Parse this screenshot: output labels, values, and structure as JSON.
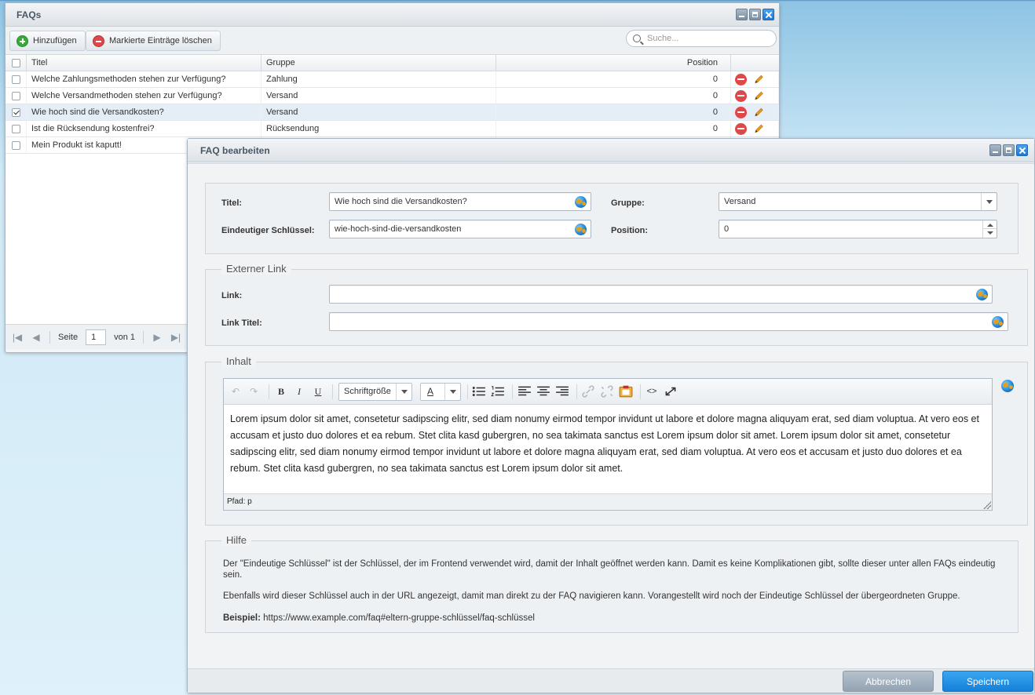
{
  "list_window": {
    "title": "FAQs",
    "add_label": "Hinzufügen",
    "delete_label": "Markierte Einträge löschen",
    "search_placeholder": "Suche...",
    "columns": {
      "title": "Titel",
      "group": "Gruppe",
      "position": "Position"
    },
    "rows": [
      {
        "title": "Welche Zahlungsmethoden stehen zur Verfügung?",
        "group": "Zahlung",
        "position": "0",
        "checked": false
      },
      {
        "title": "Welche Versandmethoden stehen zur Verfügung?",
        "group": "Versand",
        "position": "0",
        "checked": false
      },
      {
        "title": "Wie hoch sind die Versandkosten?",
        "group": "Versand",
        "position": "0",
        "checked": true
      },
      {
        "title": "Ist die Rücksendung kostenfrei?",
        "group": "Rücksendung",
        "position": "0",
        "checked": false
      },
      {
        "title": "Mein Produkt ist kaputt!",
        "group": "",
        "position": "",
        "checked": false
      }
    ],
    "pager": {
      "page_label": "Seite",
      "page": "1",
      "of_label": "von 1"
    }
  },
  "edit_window": {
    "title": "FAQ bearbeiten",
    "fields": {
      "title_label": "Titel:",
      "title_value": "Wie hoch sind die Versandkosten?",
      "key_label": "Eindeutiger Schlüssel:",
      "key_value": "wie-hoch-sind-die-versandkosten",
      "group_label": "Gruppe:",
      "group_value": "Versand",
      "position_label": "Position:",
      "position_value": "0"
    },
    "external_link": {
      "legend": "Externer Link",
      "link_label": "Link:",
      "link_value": "",
      "link_title_label": "Link Titel:",
      "link_title_value": ""
    },
    "content": {
      "legend": "Inhalt",
      "font_size_label": "Schriftgröße",
      "text_color_glyph": "A",
      "text": "Lorem ipsum dolor sit amet, consetetur sadipscing elitr, sed diam nonumy eirmod tempor invidunt ut labore et dolore magna aliquyam erat, sed diam voluptua. At vero eos et accusam et justo duo dolores et ea rebum. Stet clita kasd gubergren, no sea takimata sanctus est Lorem ipsum dolor sit amet. Lorem ipsum dolor sit amet, consetetur sadipscing elitr, sed diam nonumy eirmod tempor invidunt ut labore et dolore magna aliquyam erat, sed diam voluptua. At vero eos et accusam et justo duo dolores et ea rebum. Stet clita kasd gubergren, no sea takimata sanctus est Lorem ipsum dolor sit amet.",
      "path": "Pfad: p"
    },
    "help": {
      "legend": "Hilfe",
      "p1": "Der \"Eindeutige Schlüssel\" ist der Schlüssel, der im Frontend verwendet wird, damit der Inhalt geöffnet werden kann. Damit es keine Komplikationen gibt, sollte dieser unter allen FAQs eindeutig sein.",
      "p2": "Ebenfalls wird dieser Schlüssel auch in der URL angezeigt, damit man direkt zu der FAQ navigieren kann. Vorangestellt wird noch der Eindeutige Schlüssel der übergeordneten Gruppe.",
      "example_label": "Beispiel:",
      "example_value": "https://www.example.com/faq#eltern-gruppe-schlüssel/faq-schlüssel"
    },
    "cancel_label": "Abbrechen",
    "save_label": "Speichern"
  },
  "icons": {
    "add": "plus-circle-icon",
    "remove": "minus-circle-icon",
    "edit": "pencil-icon",
    "translate": "globe-icon",
    "search": "search-icon"
  },
  "colors": {
    "accent": "#1f7fd6",
    "add_green": "#3aa83a",
    "delete_red": "#e04848",
    "selected_row": "#e5eef6"
  }
}
